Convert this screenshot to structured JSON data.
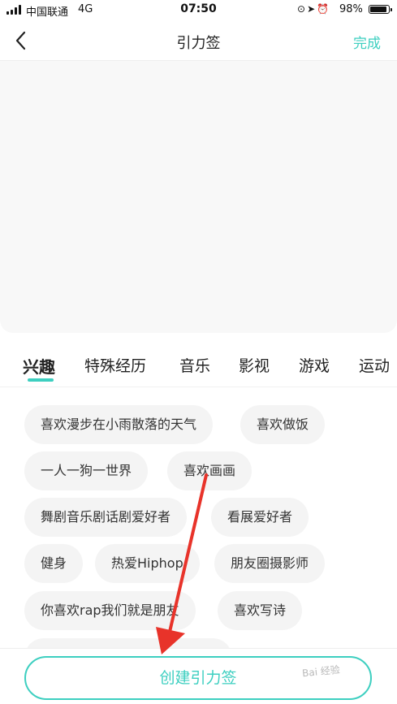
{
  "status_bar": {
    "carrier": "中国联通",
    "network": "4G",
    "time": "07:50",
    "battery": "98%"
  },
  "nav": {
    "title": "引力签",
    "done_label": "完成"
  },
  "tabs": [
    "兴趣",
    "特殊经历",
    "音乐",
    "影视",
    "游戏",
    "运动"
  ],
  "active_tab": "兴趣",
  "tags": [
    "喜欢漫步在小雨散落的天气",
    "喜欢做饭",
    "一人一狗一世界",
    "喜欢画画",
    "舞剧音乐剧话剧爱好者",
    "看展爱好者",
    "健身",
    "热爱Hiphop",
    "朋友圈摄影师",
    "你喜欢rap我们就是朋友",
    "喜欢写诗"
  ],
  "create_button_label": "创建引力签",
  "watermark": "Bai 经验",
  "colors": {
    "accent": "#3dcfc0",
    "arrow": "#e8332a"
  }
}
